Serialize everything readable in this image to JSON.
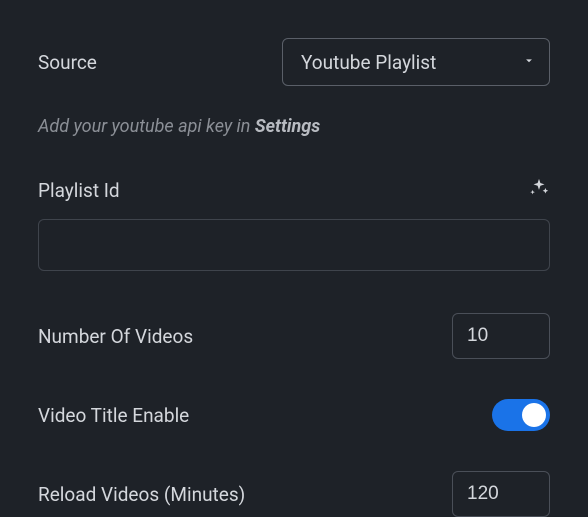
{
  "source": {
    "label": "Source",
    "selected": "Youtube Playlist"
  },
  "hint": {
    "prefix": "Add your youtube api key in ",
    "strong": "Settings"
  },
  "playlistId": {
    "label": "Playlist Id",
    "value": ""
  },
  "numberOfVideos": {
    "label": "Number Of Videos",
    "value": "10"
  },
  "videoTitleEnable": {
    "label": "Video Title Enable",
    "value": true
  },
  "reloadVideos": {
    "label": "Reload Videos (Minutes)",
    "value": "120"
  }
}
